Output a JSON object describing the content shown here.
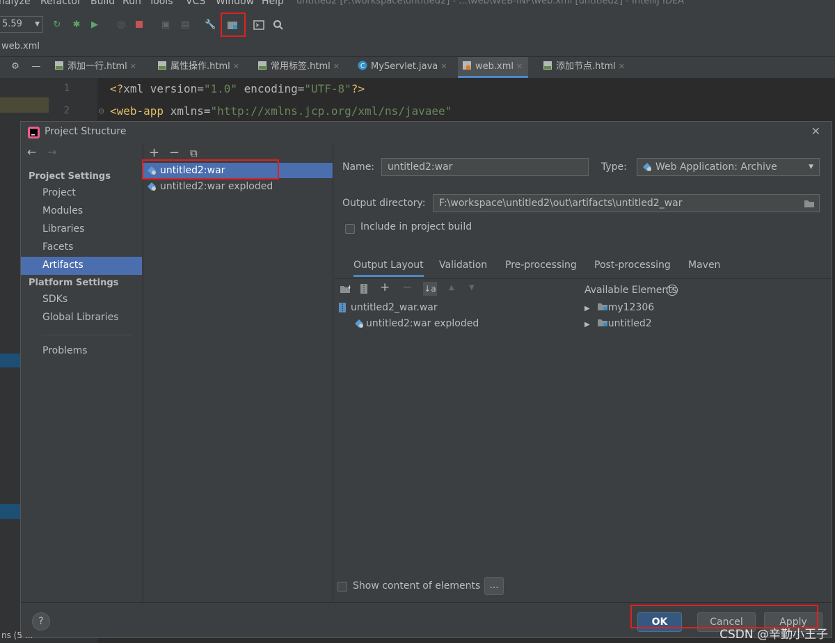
{
  "menu": {
    "items": [
      "nalyze",
      "Refactor",
      "Build",
      "Run",
      "Tools",
      "VCS",
      "Window",
      "Help"
    ],
    "window_title": "untitled2 [F:\\workspace\\untitled2] - ...\\web\\WEB-INF\\web.xml [untitled2] - IntelliJ IDEA"
  },
  "toolbar": {
    "run_config": "5.59"
  },
  "breadcrumb": "web.xml",
  "editor_tabs": [
    {
      "label": "添加一行.html",
      "icon": "html-file-icon"
    },
    {
      "label": "属性操作.html",
      "icon": "html-file-icon"
    },
    {
      "label": "常用标签.html",
      "icon": "html-file-icon"
    },
    {
      "label": "MyServlet.java",
      "icon": "java-class-icon"
    },
    {
      "label": "web.xml",
      "icon": "xml-file-icon",
      "active": true
    },
    {
      "label": "添加节点.html",
      "icon": "html-file-icon"
    }
  ],
  "code": {
    "line1_num": "1",
    "line1_p1": "<?",
    "line1_p2": "xml version=",
    "line1_p3": "\"1.0\"",
    "line1_p4": " encoding=",
    "line1_p5": "\"UTF-8\"",
    "line1_p6": "?>",
    "line2_num": "2",
    "line2_p1": "<web-app",
    "line2_p2": " xmlns=",
    "line2_p3": "\"http://xmlns.jcp.org/xml/ns/javaee\""
  },
  "dialog": {
    "title": "Project Structure",
    "close": "✕",
    "nav": {
      "back": "←",
      "forward": "→",
      "project_settings": "Project Settings",
      "items_project": [
        "Project",
        "Modules",
        "Libraries",
        "Facets",
        "Artifacts"
      ],
      "platform_settings": "Platform Settings",
      "items_platform": [
        "SDKs",
        "Global Libraries"
      ],
      "problems": "Problems",
      "selected": "Artifacts"
    },
    "list_toolbar": {
      "add": "+",
      "remove": "−",
      "copy": "⧉"
    },
    "artifacts": [
      "untitled2:war",
      "untitled2:war exploded"
    ],
    "name_label": "Name:",
    "name_value": "untitled2:war",
    "type_label": "Type:",
    "type_value": "Web Application: Archive",
    "output_dir_label": "Output directory:",
    "output_dir_value": "F:\\workspace\\untitled2\\out\\artifacts\\untitled2_war",
    "include_build": "Include in project build",
    "subtabs": [
      "Output Layout",
      "Validation",
      "Pre-processing",
      "Post-processing",
      "Maven"
    ],
    "available_elements": "Available Elements",
    "layout_tree": [
      "untitled2_war.war",
      "untitled2:war exploded"
    ],
    "available_tree": [
      "my12306",
      "untitled2"
    ],
    "show_content": "Show content of elements",
    "ellipsis": "...",
    "help": "?",
    "ok": "OK",
    "cancel": "Cancel",
    "apply": "Apply"
  },
  "status_bottom_partial": "ns (5 ...",
  "watermark": "CSDN @辛勤小王子",
  "colors": {
    "selection": "#4b6eaf",
    "annotation_red": "#e02020",
    "panel": "#3c3f41",
    "editor_bg": "#2b2b2b"
  }
}
